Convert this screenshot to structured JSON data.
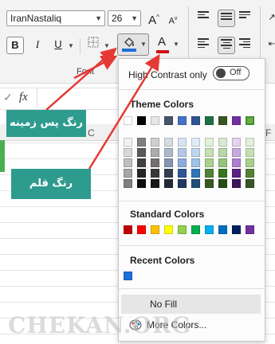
{
  "ribbon": {
    "font_name": "IranNastaliq",
    "font_size": "26",
    "grow_font_glyph": "A",
    "shrink_font_glyph": "A",
    "bold_label": "B",
    "italic_label": "I",
    "underline_label": "U",
    "font_color_glyph": "A",
    "group_label": "Font",
    "fill_color_bar": "#1e6fd9",
    "font_color_bar": "#d01010"
  },
  "formula_bar": {
    "fx_label": "fx"
  },
  "column_headers": {
    "col_c": "C",
    "col_f": "F"
  },
  "dropdown": {
    "high_contrast_label": "High Contrast only",
    "toggle_label": "Off",
    "theme_title": "Theme Colors",
    "standard_title": "Standard Colors",
    "recent_title": "Recent Colors",
    "no_fill_label": "No Fill",
    "more_colors_label": "More Colors..."
  },
  "theme_colors": {
    "top": [
      "#ffffff",
      "#000000",
      "#e7e6e6",
      "#44546a",
      "#4472c4",
      "#2f5597",
      "#1e7145",
      "#375623",
      "#7030a0",
      "#70ad47"
    ],
    "shades": [
      [
        "#f2f2f2",
        "#d9d9d9",
        "#bfbfbf",
        "#a6a6a6",
        "#808080"
      ],
      [
        "#7f7f7f",
        "#595959",
        "#404040",
        "#262626",
        "#0d0d0d"
      ],
      [
        "#d0cece",
        "#aeabab",
        "#757070",
        "#3a3838",
        "#171616"
      ],
      [
        "#d6dce4",
        "#adb9ca",
        "#8496b0",
        "#333f4f",
        "#222a35"
      ],
      [
        "#dae3f3",
        "#b4c7e7",
        "#8faadc",
        "#2f5597",
        "#1f3864"
      ],
      [
        "#deebf7",
        "#bdd7ee",
        "#9dc3e6",
        "#2e75b6",
        "#1f4e79"
      ],
      [
        "#e2f0d9",
        "#c5e0b4",
        "#a9d18e",
        "#548235",
        "#385723"
      ],
      [
        "#d9ead3",
        "#b6d7a8",
        "#93c47d",
        "#38761d",
        "#274e13"
      ],
      [
        "#e4d4f0",
        "#c9a9e0",
        "#ae7fd1",
        "#5b2282",
        "#3c1657"
      ],
      [
        "#e2efd9",
        "#c5e0b3",
        "#a8d08d",
        "#538135",
        "#375623"
      ]
    ]
  },
  "standard_colors": [
    "#c00000",
    "#ff0000",
    "#ffc000",
    "#ffff00",
    "#92d050",
    "#00b050",
    "#00b0f0",
    "#0070c0",
    "#002060",
    "#7030a0"
  ],
  "recent_colors": [
    "#1e6fd9"
  ],
  "annotations": {
    "fill_color_callout": "رنگ پس زمینه",
    "font_color_callout": "رنگ قلم",
    "watermark": "CHEKAN.ORG"
  }
}
